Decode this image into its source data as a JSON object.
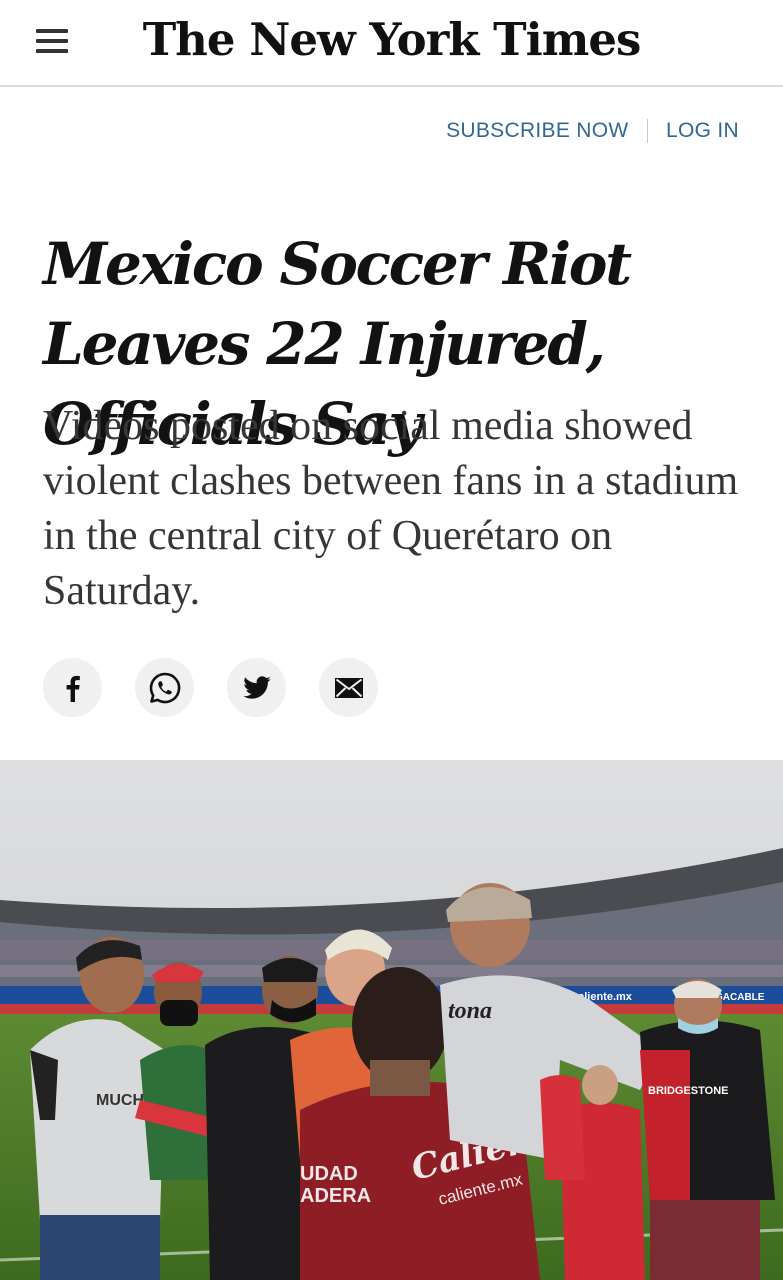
{
  "header": {
    "masthead": "The New York Times",
    "menu_icon": "hamburger-menu-icon"
  },
  "account": {
    "subscribe_label": "SUBSCRIBE NOW",
    "login_label": "LOG IN",
    "link_color": "#326891"
  },
  "article": {
    "headline": "Mexico Soccer Riot Leaves 22 Injured, Officials Say",
    "summary": "Videos posted on social media showed violent clashes between fans in a stadium in the central city of Querétaro on Saturday."
  },
  "share": {
    "icons": [
      "facebook-icon",
      "whatsapp-icon",
      "twitter-icon",
      "email-icon"
    ]
  },
  "photo": {
    "jersey_sponsor": "Caliente",
    "jersey_sponsor_sub": "caliente.mx",
    "jersey_chest_lines": [
      "UDAD",
      "ADERA"
    ],
    "board_text": "caliente.mx",
    "board_text_2": "MEGACABLE",
    "shirt_text": "tona",
    "shirt_text_2": "BRIDGESTONE",
    "shirt_text_3": "MUCH"
  }
}
